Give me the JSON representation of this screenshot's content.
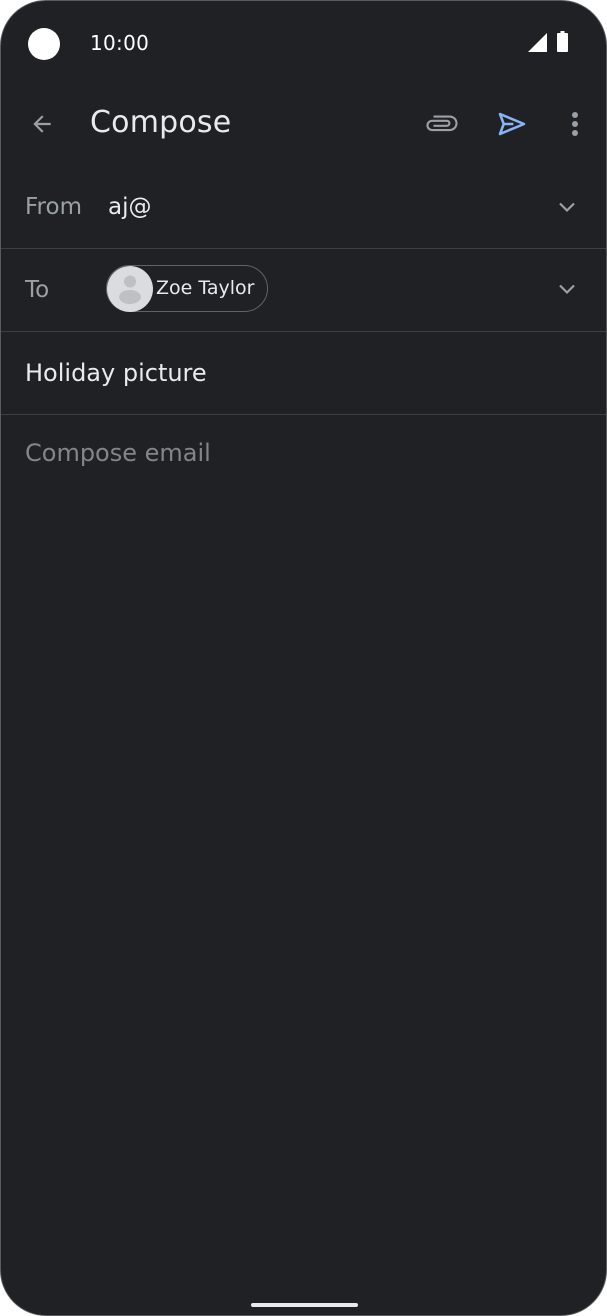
{
  "status_bar": {
    "time": "10:00"
  },
  "app_bar": {
    "title": "Compose",
    "back_icon": "arrow-back-icon",
    "attach_icon": "paperclip-icon",
    "send_icon": "send-icon",
    "more_icon": "more-vert-icon"
  },
  "from_field": {
    "label": "From",
    "value": "aj@"
  },
  "to_field": {
    "label": "To",
    "recipients": [
      {
        "name": "Zoe Taylor",
        "avatar_icon": "person-avatar-icon"
      }
    ]
  },
  "subject_field": {
    "value": "Holiday picture"
  },
  "body_field": {
    "placeholder": "Compose email"
  },
  "colors": {
    "background": "#202124",
    "primary_text": "#e8eaed",
    "secondary_text": "#9aa0a6",
    "send_accent": "#8ab4f8",
    "divider": "#3c4043"
  }
}
